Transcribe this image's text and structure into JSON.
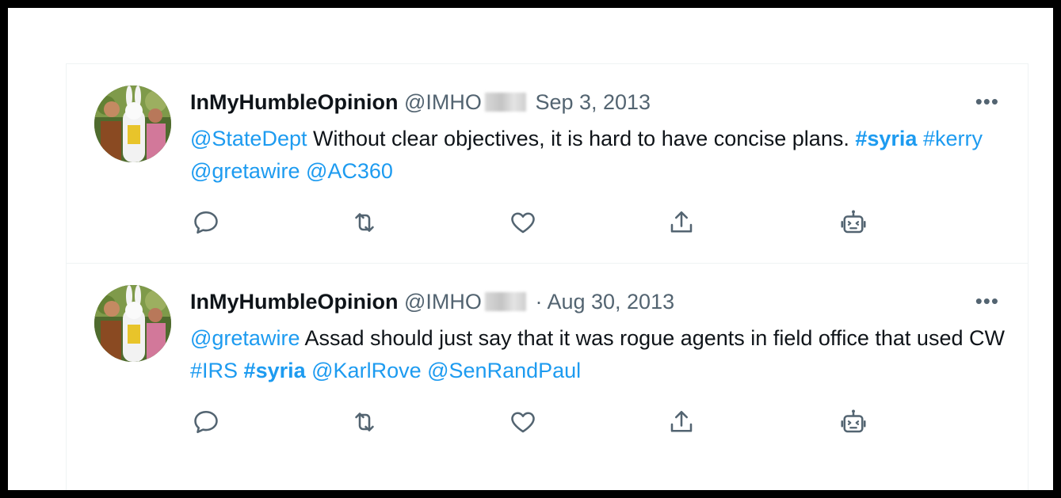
{
  "tweets": [
    {
      "name": "InMyHumbleOpinion",
      "handle": "@IMHO",
      "separator": "",
      "date": "Sep 3, 2013",
      "more": "•••",
      "segments": [
        {
          "text": "@StateDept",
          "style": "link"
        },
        {
          "text": " Without clear objectives, it is hard to have concise plans. ",
          "style": "plain"
        },
        {
          "text": "#syria",
          "style": "tag-bold"
        },
        {
          "text": " ",
          "style": "plain"
        },
        {
          "text": "#kerry",
          "style": "link"
        },
        {
          "text": " ",
          "style": "plain"
        },
        {
          "text": "@gretawire",
          "style": "link"
        },
        {
          "text": " ",
          "style": "plain"
        },
        {
          "text": "@AC360",
          "style": "link"
        }
      ]
    },
    {
      "name": "InMyHumbleOpinion",
      "handle": "@IMHO",
      "separator": "·",
      "date": "Aug 30, 2013",
      "more": "•••",
      "segments": [
        {
          "text": "@gretawire",
          "style": "link"
        },
        {
          "text": " Assad should just say that it was rogue agents in field office that used CW ",
          "style": "plain"
        },
        {
          "text": "#IRS",
          "style": "link"
        },
        {
          "text": " ",
          "style": "plain"
        },
        {
          "text": "#syria",
          "style": "tag-bold"
        },
        {
          "text": " ",
          "style": "plain"
        },
        {
          "text": "@KarlRove",
          "style": "link"
        },
        {
          "text": " ",
          "style": "plain"
        },
        {
          "text": "@SenRandPaul",
          "style": "link"
        }
      ]
    }
  ],
  "icons": [
    "reply-icon",
    "retweet-icon",
    "like-icon",
    "share-icon",
    "bot-icon"
  ],
  "colors": {
    "link": "#1d9bf0",
    "text": "#0f1419",
    "muted": "#536471",
    "border": "#eff3f4"
  }
}
